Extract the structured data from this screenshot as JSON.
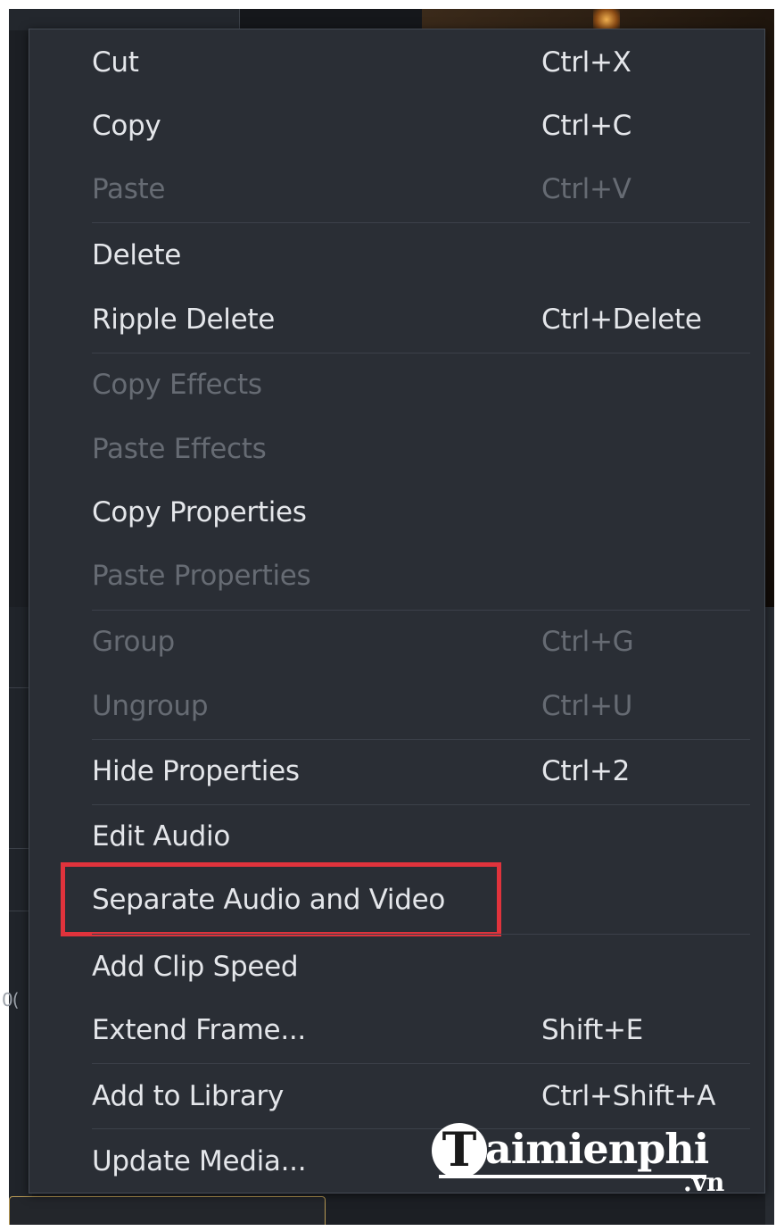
{
  "background": {
    "left_panel_label": "0("
  },
  "menu": {
    "items": [
      {
        "label": "Cut",
        "shortcut": "Ctrl+X",
        "enabled": true
      },
      {
        "label": "Copy",
        "shortcut": "Ctrl+C",
        "enabled": true
      },
      {
        "label": "Paste",
        "shortcut": "Ctrl+V",
        "enabled": false
      },
      {
        "label": "Delete",
        "shortcut": "",
        "enabled": true
      },
      {
        "label": "Ripple Delete",
        "shortcut": "Ctrl+Delete",
        "enabled": true
      },
      {
        "label": "Copy Effects",
        "shortcut": "",
        "enabled": false
      },
      {
        "label": "Paste Effects",
        "shortcut": "",
        "enabled": false
      },
      {
        "label": "Copy Properties",
        "shortcut": "",
        "enabled": true
      },
      {
        "label": "Paste Properties",
        "shortcut": "",
        "enabled": false
      },
      {
        "label": "Group",
        "shortcut": "Ctrl+G",
        "enabled": false
      },
      {
        "label": "Ungroup",
        "shortcut": "Ctrl+U",
        "enabled": false
      },
      {
        "label": "Hide Properties",
        "shortcut": "Ctrl+2",
        "enabled": true
      },
      {
        "label": "Edit Audio",
        "shortcut": "",
        "enabled": true
      },
      {
        "label": "Separate Audio and Video",
        "shortcut": "",
        "enabled": true,
        "highlighted": true
      },
      {
        "label": "Add Clip Speed",
        "shortcut": "",
        "enabled": true
      },
      {
        "label": "Extend Frame...",
        "shortcut": "Shift+E",
        "enabled": true
      },
      {
        "label": "Add to Library",
        "shortcut": "Ctrl+Shift+A",
        "enabled": true
      },
      {
        "label": "Update Media...",
        "shortcut": "",
        "enabled": true
      }
    ]
  },
  "watermark": {
    "initial": "T",
    "name": "aimienphi",
    "domain": ".vn"
  },
  "colors": {
    "menu_background": "#2a2e35",
    "enabled_text": "#e4e6ea",
    "disabled_text": "#666b73",
    "highlight_border": "#e0333c"
  }
}
